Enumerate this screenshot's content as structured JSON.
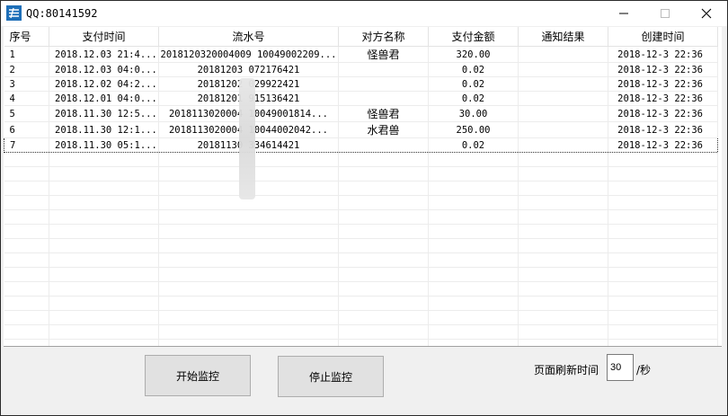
{
  "window": {
    "title": "QQ:80141592"
  },
  "grid": {
    "columns": [
      "序号",
      "支付时间",
      "流水号",
      "对方名称",
      "支付金额",
      "通知结果",
      "创建时间"
    ],
    "rows": [
      [
        "1",
        "2018.12.03 21:4...",
        "2018120320004009  10049002209...",
        "怪兽君",
        "320.00",
        "",
        "2018-12-3 22:36"
      ],
      [
        "2",
        "2018.12.03 04:0...",
        "20181203   072176421",
        "",
        "0.02",
        "",
        "2018-12-3 22:36"
      ],
      [
        "3",
        "2018.12.02 04:2...",
        "20181202   029922421",
        "",
        "0.02",
        "",
        "2018-12-3 22:36"
      ],
      [
        "4",
        "2018.12.01 04:0...",
        "20181201   915136421",
        "",
        "0.02",
        "",
        "2018-12-3 22:36"
      ],
      [
        "5",
        "2018.11.30 12:5...",
        "2018113020004     10049001814...",
        "怪兽君",
        "30.00",
        "",
        "2018-12-3 22:36"
      ],
      [
        "6",
        "2018.11.30 12:1...",
        "2018113020004     10044002042...",
        "水君兽",
        "250.00",
        "",
        "2018-12-3 22:36"
      ],
      [
        "7",
        "2018.11.30 05:1...",
        "20181130   334614421",
        "",
        "0.02",
        "",
        "2018-12-3 22:36"
      ]
    ]
  },
  "controls": {
    "start_label": "开始监控",
    "stop_label": "停止监控",
    "refresh_label": "页面刷新时间",
    "refresh_value": "30",
    "refresh_unit": "/秒"
  }
}
